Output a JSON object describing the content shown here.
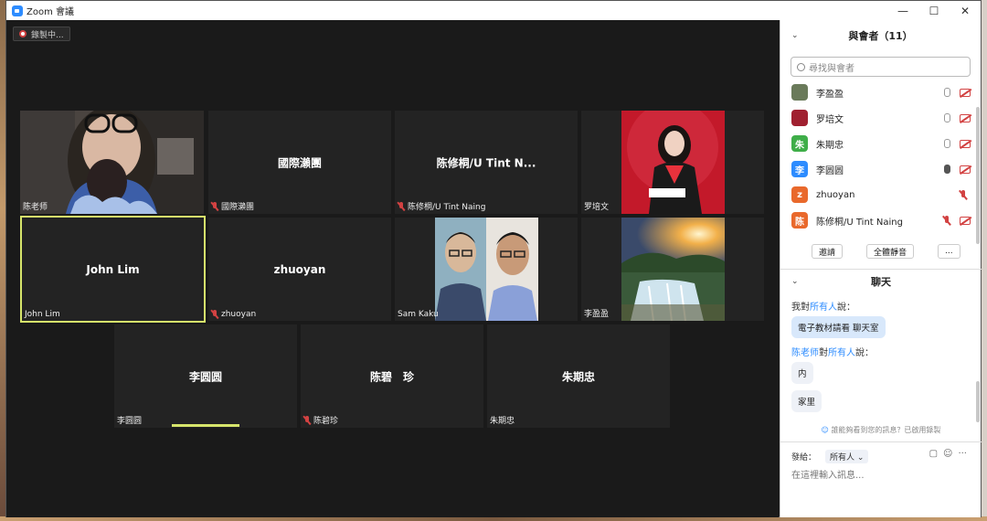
{
  "window": {
    "title": "Zoom 會議",
    "minimize": "—",
    "maximize": "☐",
    "close": "✕"
  },
  "recording": {
    "label": "錄製中..."
  },
  "tiles": [
    {
      "id": "t1",
      "label": "陈老师",
      "muted": false,
      "type": "video"
    },
    {
      "id": "t2",
      "name": "國際瀨團",
      "label": "國際瀨團",
      "muted": true
    },
    {
      "id": "t3",
      "name": "陈修桐/U Tint N...",
      "label": "陈修桐/U Tint Naing",
      "muted": true
    },
    {
      "id": "t4",
      "label": "罗培文",
      "muted": false,
      "type": "photo"
    },
    {
      "id": "t5",
      "name": "John Lim",
      "label": "John Lim",
      "muted": false,
      "active": true
    },
    {
      "id": "t6",
      "name": "zhuoyan",
      "label": "zhuoyan",
      "muted": true
    },
    {
      "id": "t7",
      "label": "Sam Kaku",
      "muted": false,
      "type": "photo"
    },
    {
      "id": "t8",
      "label": "李盈盈",
      "muted": false,
      "type": "photo"
    },
    {
      "id": "t9",
      "name": "李圆圆",
      "label": "李圆圆",
      "muted": false
    },
    {
      "id": "t10",
      "name": "陈碧　珍",
      "label": "陈碧珍",
      "muted": true
    },
    {
      "id": "t11",
      "name": "朱期忠",
      "label": "朱期忠",
      "muted": false
    }
  ],
  "panel": {
    "participants_title": "與會者（11）",
    "search_placeholder": "尋找與會者",
    "participants": [
      {
        "name": "李盈盈",
        "avatar": "",
        "color": "#6a7a5a"
      },
      {
        "name": "罗培文",
        "avatar": "",
        "color": "#a02030"
      },
      {
        "name": "朱期忠",
        "avatar": "朱",
        "color": "#3fae49"
      },
      {
        "name": "李圆圆",
        "avatar": "李",
        "color": "#2d8cff"
      },
      {
        "name": "zhuoyan",
        "avatar": "z",
        "color": "#e9692c"
      },
      {
        "name": "陈修桐/U Tint Naing",
        "avatar": "陈",
        "color": "#e9692c"
      }
    ],
    "invite": "邀請",
    "mute_all": "全體靜音",
    "more": "...",
    "chat_title": "聊天",
    "chat": [
      {
        "sender_prefix": "我對",
        "sender_link": "所有人",
        "sender_suffix": "說：",
        "messages": [
          "電子教材請看 聊天室"
        ],
        "mine": true
      },
      {
        "sender_prefix": "",
        "sender_link": "陈老师",
        "sender_mid": "對",
        "sender_link2": "所有人",
        "sender_suffix": "說：",
        "messages": [
          "内",
          "家里"
        ]
      }
    ],
    "notice": "誰能夠看到您的訊息？已啟用錄製",
    "to_label": "發給：",
    "to_value": "所有人 ⌄",
    "input_placeholder": "在這裡輸入訊息..."
  },
  "colors": {
    "accent": "#2d8cff",
    "active_speaker": "#d6e56b",
    "muted": "#d24242"
  }
}
